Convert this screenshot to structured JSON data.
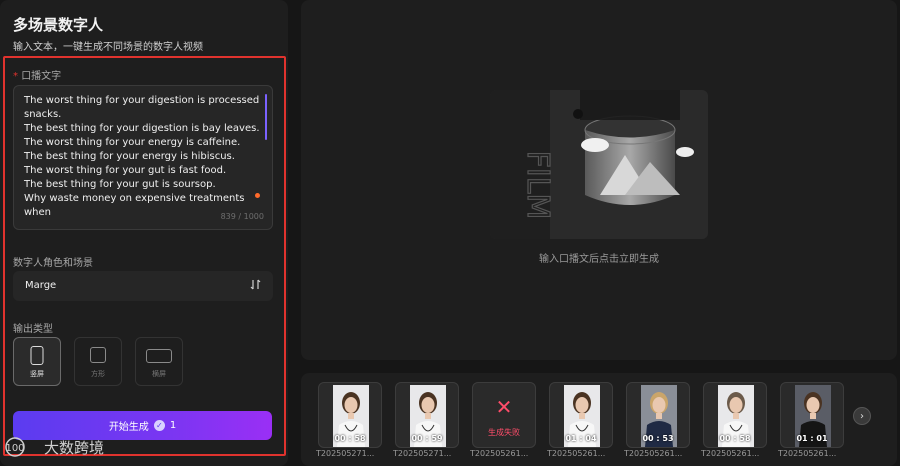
{
  "left_panel": {
    "title": "多场景数字人",
    "subtitle": "输入文本，一键生成不同场景的数字人视频",
    "script_label_required": "*",
    "script_label": "口播文字",
    "script_lines": [
      "The worst thing for your digestion is processed",
      "snacks.",
      "The best thing for your digestion is bay leaves.",
      "The worst thing for your energy is caffeine.",
      "The best thing for your energy is hibiscus.",
      "The worst thing for your gut is fast food.",
      "The best thing for your gut is soursop.",
      "Why waste money on expensive treatments when"
    ],
    "char_count": "839 / 1000",
    "role_label": "数字人角色和场景",
    "role_value": "Marge",
    "role_icon": "switch-icon",
    "output_label": "输出类型",
    "ratios": [
      {
        "label": "竖屏",
        "active": true
      },
      {
        "label": "方形",
        "active": false
      },
      {
        "label": "横屏",
        "active": false
      }
    ],
    "generate_label": "开始生成",
    "generate_cost": "1",
    "accent_color": "#6a3cf2",
    "highlight_color": "#e0332e"
  },
  "preview": {
    "film_text": "FILM",
    "hint": "输入口播文后点击立即生成"
  },
  "history": {
    "items": [
      {
        "duration": "00 : 58",
        "name": "T202505271...",
        "status": "ok",
        "style": "doctor-female"
      },
      {
        "duration": "00 : 59",
        "name": "T202505271...",
        "status": "ok",
        "style": "doctor-female"
      },
      {
        "duration": "",
        "name": "T202505261...",
        "status": "failed",
        "fail_label": "生成失败",
        "style": "none"
      },
      {
        "duration": "01 : 04",
        "name": "T202505261...",
        "status": "ok",
        "style": "doctor-female"
      },
      {
        "duration": "00 : 53",
        "name": "T202505261...",
        "status": "ok",
        "style": "business-female"
      },
      {
        "duration": "00 : 58",
        "name": "T202505261...",
        "status": "ok",
        "style": "doctor-male"
      },
      {
        "duration": "01 : 01",
        "name": "T202505261...",
        "status": "ok",
        "style": "business-female-dark"
      }
    ],
    "next_icon": "chevron-right-icon"
  },
  "watermark": {
    "text": "大数跨境",
    "logo": "100"
  }
}
